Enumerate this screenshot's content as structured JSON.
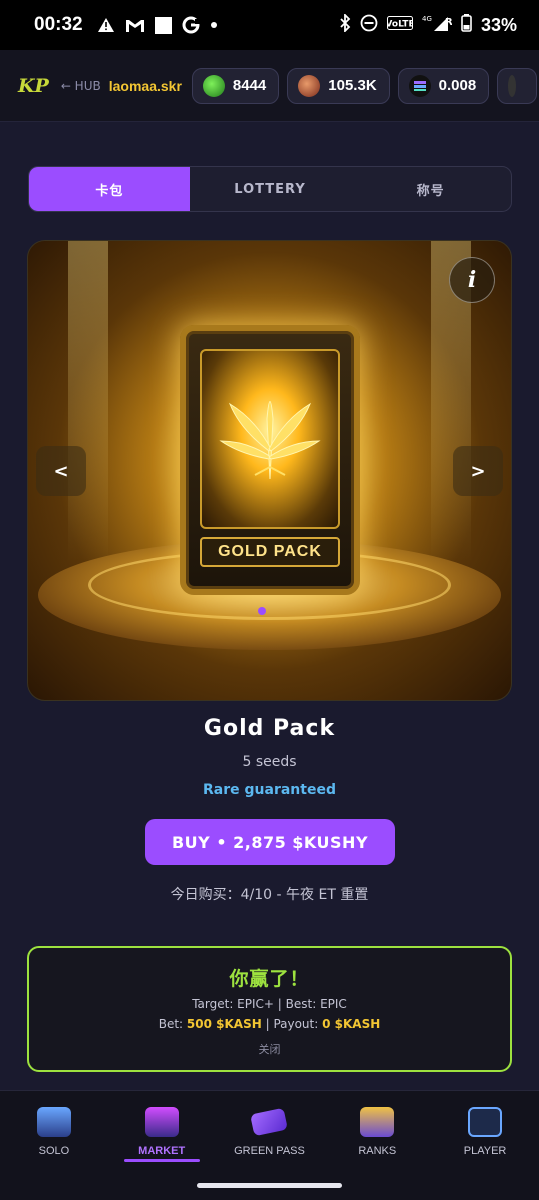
{
  "status": {
    "time": "00:32",
    "battery": "33%",
    "network": "4G"
  },
  "hub": {
    "logo": "KP",
    "back_label": "← HUB",
    "username": "laomaa.skr",
    "balances": [
      {
        "icon": "green-coin-icon",
        "value": "8444"
      },
      {
        "icon": "kush-coin-icon",
        "value": "105.3K"
      },
      {
        "icon": "solana-icon",
        "value": "0.008"
      }
    ]
  },
  "tabs": [
    {
      "label": "卡包",
      "active": true
    },
    {
      "label": "LOTTERY",
      "active": false
    },
    {
      "label": "称号",
      "active": false
    }
  ],
  "hero": {
    "card_label": "GOLD PACK",
    "prev": "<",
    "next": ">",
    "info": "i"
  },
  "pack": {
    "title": "Gold Pack",
    "seeds": "5 seeds",
    "rarity": "Rare guaranteed",
    "buy_label": "BUY • 2,875 $KUSHY",
    "daily_limit": "今日购买：4/10 - 午夜 ET 重置"
  },
  "result": {
    "headline": "你赢了！",
    "target_line": "Target: EPIC+ | Best: EPIC",
    "bet_label": "Bet: ",
    "bet_value": "500 $KASH",
    "payout_label": " | Payout: ",
    "payout_value": "0 $KASH",
    "close_label": "关闭"
  },
  "nav": [
    {
      "label": "SOLO",
      "active": false
    },
    {
      "label": "MARKET",
      "active": true
    },
    {
      "label": "GREEN PASS",
      "active": false
    },
    {
      "label": "RANKS",
      "active": false
    },
    {
      "label": "PLAYER",
      "active": false
    }
  ],
  "colors": {
    "accent": "#9b4dff",
    "gold": "#f3c633",
    "success": "#9de23f",
    "info": "#5cb8f0"
  }
}
